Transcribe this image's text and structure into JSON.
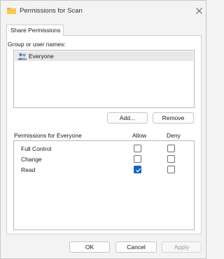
{
  "window": {
    "title": "Permissions for Scan",
    "folder_icon": "folder-icon",
    "close_icon": "close-icon"
  },
  "tabs": [
    {
      "label": "Share Permissions",
      "active": true
    }
  ],
  "users": {
    "label": "Group or user names:",
    "items": [
      {
        "name": "Everyone",
        "icon": "users-group-icon",
        "selected": true
      }
    ],
    "add_label": "Add...",
    "remove_label": "Remove"
  },
  "permissions": {
    "header": "Permissions for Everyone",
    "allow_label": "Allow",
    "deny_label": "Deny",
    "rows": [
      {
        "name": "Full Control",
        "allow": false,
        "deny": false
      },
      {
        "name": "Change",
        "allow": false,
        "deny": false
      },
      {
        "name": "Read",
        "allow": true,
        "deny": false
      }
    ]
  },
  "footer": {
    "ok_label": "OK",
    "cancel_label": "Cancel",
    "apply_label": "Apply",
    "apply_enabled": false
  },
  "colors": {
    "check_accent": "#1565c0",
    "selected_row": "#e8e8e8"
  }
}
